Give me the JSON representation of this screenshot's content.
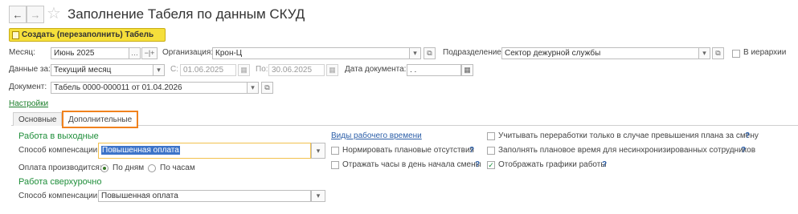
{
  "header": {
    "back_icon": "←",
    "forward_icon": "→",
    "favorite_icon": "☆",
    "title": "Заполнение Табеля по данным СКУД"
  },
  "toolbar": {
    "create_label": "Создать (перезаполнить) Табель"
  },
  "row1": {
    "month_label": "Месяц:",
    "month_value": "Июнь 2025",
    "org_label": "Организация:",
    "org_value": "Крон-Ц",
    "dept_label": "Подразделение:",
    "dept_value": "Сектор дежурной службы",
    "hierarchy_label": "В иерархии"
  },
  "row2": {
    "data_for_label": "Данные за:",
    "data_for_value": "Текущий месяц",
    "from_label": "С:",
    "from_value": "01.06.2025",
    "to_label": "По:",
    "to_value": "30.06.2025",
    "doc_date_label": "Дата документа:",
    "doc_date_value": " .  ."
  },
  "row3": {
    "document_label": "Документ:",
    "document_value": "Табель 0000-000011 от 01.04.2026"
  },
  "settings_link": "Настройки",
  "tabs": [
    {
      "label": "Основные"
    },
    {
      "label": "Дополнительные"
    }
  ],
  "weekends": {
    "section_title": "Работа в выходные",
    "comp_label": "Способ компенсации:",
    "comp_value": "Повышенная оплата",
    "pay_label": "Оплата производится:",
    "pay_by_days": "По дням",
    "pay_by_hours": "По часам"
  },
  "overtime": {
    "section_title": "Работа сверхурочно",
    "comp_label": "Способ компенсации:",
    "comp_value": "Повышенная оплата"
  },
  "middle": {
    "work_time_link": "Виды рабочего времени",
    "normalize_label": "Нормировать плановые отсутствия",
    "start_day_label": "Отражать часы в день начала смены"
  },
  "right": {
    "overtime_only_label": "Учитывать переработки только в случае превышения плана за смену",
    "fill_plan_label": "Заполнять плановое время для несинхронизированных сотрудников",
    "show_schedules_label": "Отображать графики работы"
  },
  "help_mark": "?",
  "colors": {
    "accent_yellow": "#f5df3b",
    "section_green": "#1f8e3a",
    "link_blue": "#2b5ea8",
    "tab_orange": "#f0821e"
  }
}
